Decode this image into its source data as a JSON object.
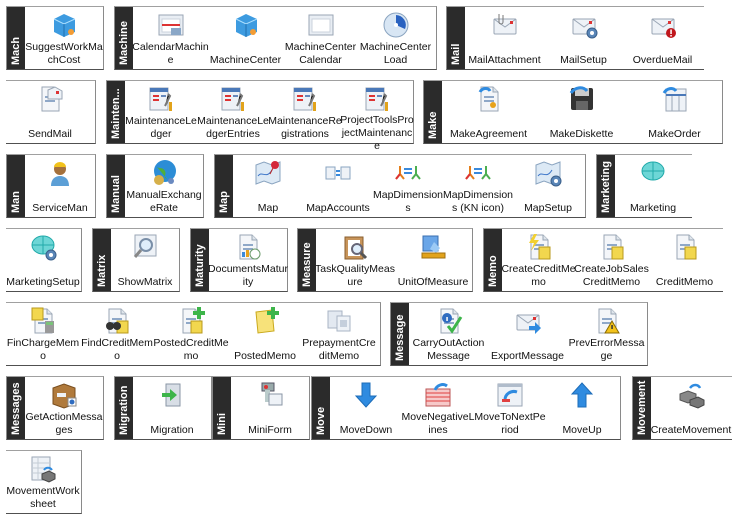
{
  "groups": [
    {
      "title": "Mach",
      "items": [
        {
          "label": "SuggestWorkMachCost",
          "icon": "blue-cube-icon"
        }
      ]
    },
    {
      "title": "Machine",
      "items": [
        {
          "label": "CalendarMachine",
          "icon": "calendar-machine-icon"
        },
        {
          "label": "MachineCenter",
          "icon": "machine-center-icon"
        },
        {
          "label": "MachineCenter Calendar",
          "icon": "calendar-icon"
        },
        {
          "label": "MachineCenter Load",
          "icon": "load-gauge-icon"
        }
      ]
    },
    {
      "title": "Mail",
      "items": [
        {
          "label": "MailAttachment",
          "icon": "mail-attachment-icon"
        },
        {
          "label": "MailSetup",
          "icon": "mail-setup-icon"
        },
        {
          "label": "OverdueMail",
          "icon": "overdue-mail-icon"
        }
      ]
    },
    {
      "title": "",
      "items": [
        {
          "label": "SendMail",
          "icon": "send-mail-icon"
        }
      ]
    },
    {
      "title": "Mainten...",
      "items": [
        {
          "label": "MaintenanceLedger",
          "icon": "maintenance-ledger-icon"
        },
        {
          "label": "MaintenanceLedgerEntries",
          "icon": "maintenance-ledger-entries-icon"
        },
        {
          "label": "MaintenanceRegistrations",
          "icon": "maintenance-registrations-icon"
        },
        {
          "label": "ProjectToolsProjectMaintenance",
          "icon": "project-tools-icon"
        }
      ]
    },
    {
      "title": "Make",
      "items": [
        {
          "label": "MakeAgreement",
          "icon": "make-agreement-icon"
        },
        {
          "label": "MakeDiskette",
          "icon": "floppy-disk-icon"
        },
        {
          "label": "MakeOrder",
          "icon": "make-order-icon"
        }
      ]
    },
    {
      "title": "Man",
      "items": [
        {
          "label": "ServiceMan",
          "icon": "service-man-icon"
        }
      ]
    },
    {
      "title": "Manual",
      "items": [
        {
          "label": "ManualExchangeRate",
          "icon": "globe-exchange-icon"
        }
      ]
    },
    {
      "title": "Map",
      "items": [
        {
          "label": "Map",
          "icon": "map-pin-icon"
        },
        {
          "label": "MapAccounts",
          "icon": "map-accounts-icon"
        },
        {
          "label": "MapDimensions",
          "icon": "map-dimensions-icon"
        },
        {
          "label": "MapDimensions (KN icon)",
          "icon": "map-dimensions-kn-icon"
        },
        {
          "label": "MapSetup",
          "icon": "map-setup-icon"
        }
      ]
    },
    {
      "title": "Marketing",
      "items": [
        {
          "label": "Marketing",
          "icon": "marketing-icon"
        }
      ]
    },
    {
      "title": "",
      "items": [
        {
          "label": "MarketingSetup",
          "icon": "marketing-setup-icon"
        }
      ]
    },
    {
      "title": "Matrix",
      "items": [
        {
          "label": "ShowMatrix",
          "icon": "show-matrix-icon"
        }
      ]
    },
    {
      "title": "Maturity",
      "items": [
        {
          "label": "DocumentsMaturity",
          "icon": "documents-maturity-icon"
        }
      ]
    },
    {
      "title": "Measure",
      "items": [
        {
          "label": "TaskQualityMeasure",
          "icon": "task-quality-icon"
        },
        {
          "label": "UnitOfMeasure",
          "icon": "unit-of-measure-icon"
        }
      ]
    },
    {
      "title": "Memo",
      "items": [
        {
          "label": "CreateCreditMemo",
          "icon": "create-credit-memo-icon"
        },
        {
          "label": "CreateJobSales CreditMemo",
          "icon": "create-job-sales-credit-memo-icon"
        },
        {
          "label": "CreditMemo",
          "icon": "credit-memo-icon"
        }
      ]
    },
    {
      "title": "",
      "items": [
        {
          "label": "FinChargeMemo",
          "icon": "fin-charge-memo-icon"
        },
        {
          "label": "FindCreditMemo",
          "icon": "find-credit-memo-icon"
        },
        {
          "label": "PostedCreditMemo",
          "icon": "posted-credit-memo-icon"
        },
        {
          "label": "PostedMemo",
          "icon": "posted-memo-icon"
        },
        {
          "label": "PrepaymentCreditMemo",
          "icon": "prepayment-credit-memo-icon"
        }
      ]
    },
    {
      "title": "Message",
      "items": [
        {
          "label": "CarryOutAction Message",
          "icon": "carry-out-action-icon"
        },
        {
          "label": "ExportMessage",
          "icon": "export-message-icon"
        },
        {
          "label": "PrevErrorMessage",
          "icon": "prev-error-message-icon"
        }
      ]
    },
    {
      "title": "Messages",
      "items": [
        {
          "label": "GetActionMessages",
          "icon": "get-action-messages-icon"
        }
      ]
    },
    {
      "title": "Migration",
      "items": [
        {
          "label": "Migration",
          "icon": "migration-icon"
        }
      ]
    },
    {
      "title": "Mini",
      "items": [
        {
          "label": "MiniForm",
          "icon": "mini-form-icon"
        }
      ]
    },
    {
      "title": "Move",
      "items": [
        {
          "label": "MoveDown",
          "icon": "arrow-down-icon"
        },
        {
          "label": "MoveNegativeLines",
          "icon": "move-negative-lines-icon"
        },
        {
          "label": "MoveToNextPeriod",
          "icon": "move-to-next-period-icon"
        },
        {
          "label": "MoveUp",
          "icon": "arrow-up-icon"
        }
      ]
    },
    {
      "title": "Movement",
      "items": [
        {
          "label": "CreateMovement",
          "icon": "create-movement-icon"
        }
      ]
    },
    {
      "title": "",
      "items": [
        {
          "label": "MovementWorksheet",
          "icon": "movement-worksheet-icon"
        }
      ]
    }
  ]
}
